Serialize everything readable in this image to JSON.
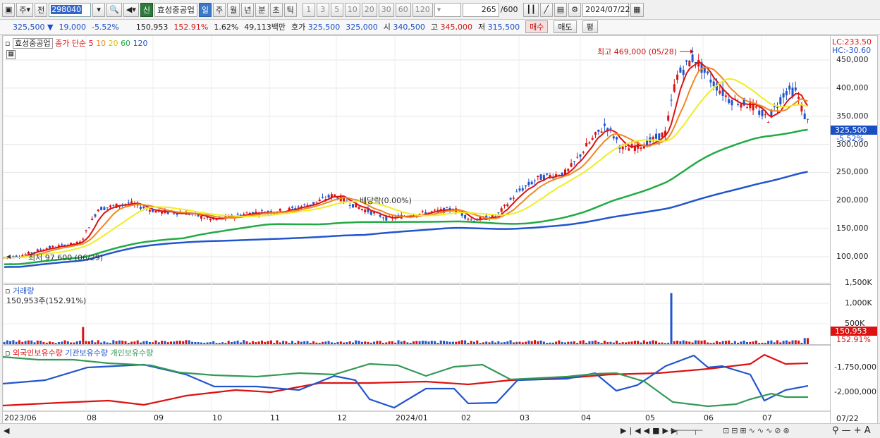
{
  "toolbar": {
    "market_label": "주",
    "period_label": "전",
    "stock_code": "298040",
    "new_badge": "신",
    "stock_name": "효성중공업",
    "periods": [
      "일",
      "주",
      "월",
      "년",
      "분",
      "초",
      "틱"
    ],
    "active_period": "일",
    "numbers": [
      "1",
      "3",
      "5",
      "10",
      "20",
      "30",
      "60",
      "120"
    ],
    "count": "265",
    "count_max": "/600",
    "date": "2024/07/22"
  },
  "quote": {
    "price": "325,500",
    "arrow": "▼",
    "change": "19,000",
    "change_pct": "-5.52%",
    "volume": "150,953",
    "volume_ratio": "152.91%",
    "turnover": "1.62%",
    "amount": "49,113백만",
    "ask_label": "호가",
    "ask": "325,500",
    "bid": "325,000",
    "open_label": "시",
    "open": "340,500",
    "high_label": "고",
    "high": "345,000",
    "low_label": "저",
    "low": "315,500",
    "buy_label": "매수",
    "sell_label": "매도",
    "eval_label": "평"
  },
  "price_panel": {
    "title": "효성중공업",
    "ma_label": "종가 단순",
    "ma_periods": [
      "5",
      "10",
      "20",
      "60",
      "120"
    ],
    "ma_colors": [
      "#dd1111",
      "#ee8822",
      "#eeee22",
      "#22aa44",
      "#2255cc"
    ],
    "lc_label": "LC:233.50",
    "hc_label": "HC:-30.60",
    "high_note": "최고 469,000 (05/28)",
    "low_note": "최저 97,600 (06/29)",
    "dividend_note": "배당락(0.00%)",
    "current_price_tag": "325,500",
    "current_pct_tag": "-5.52%",
    "y_ticks": [
      "450,000",
      "400,000",
      "350,000",
      "300,000",
      "250,000",
      "200,000",
      "150,000",
      "100,000"
    ]
  },
  "volume_panel": {
    "title": "거래량",
    "value": "150,953주(152.91%)",
    "y_ticks": [
      "1,500K",
      "1,000K",
      "500K"
    ],
    "current_tag": "150,953",
    "current_pct_tag": "152.91%"
  },
  "holding_panel": {
    "series": [
      "외국인보유수량",
      "기관보유수량",
      "개인보유수량"
    ],
    "colors": [
      "#dd1111",
      "#2255cc",
      "#339955"
    ],
    "y_ticks": [
      "-1,750,000",
      "-2,000,000"
    ]
  },
  "x_ticks": [
    "2023/06",
    "08",
    "09",
    "10",
    "11",
    "12",
    "2024/01",
    "02",
    "03",
    "04",
    "05",
    "06",
    "07"
  ],
  "x_end_label": "07/22"
}
